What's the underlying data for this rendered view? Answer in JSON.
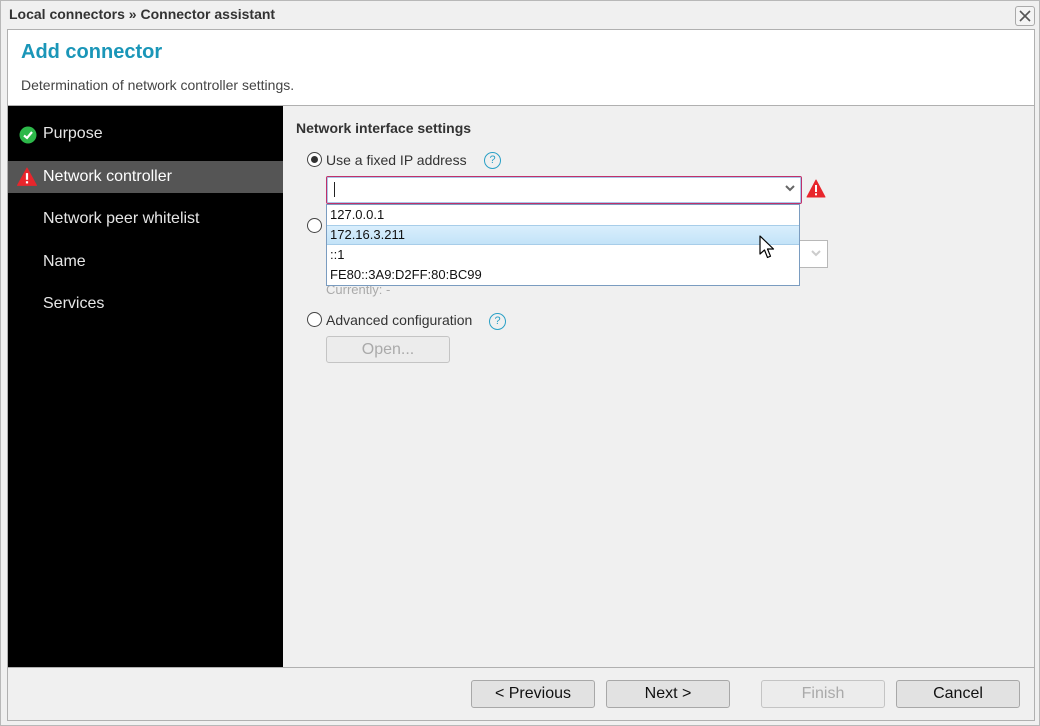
{
  "window": {
    "breadcrumb": "Local connectors » Connector assistant",
    "close_icon": "close-icon"
  },
  "header": {
    "title": "Add connector",
    "subtitle": "Determination of network controller settings."
  },
  "sidebar": {
    "items": [
      {
        "label": "Purpose",
        "status": "done",
        "icon": "check-circle-icon"
      },
      {
        "label": "Network controller",
        "status": "error",
        "icon": "warning-icon",
        "active": true
      },
      {
        "label": "Network peer whitelist",
        "status": "none"
      },
      {
        "label": "Name",
        "status": "none"
      },
      {
        "label": "Services",
        "status": "none"
      }
    ]
  },
  "content": {
    "section_title": "Network interface settings",
    "fixed_ip": {
      "label": "Use a fixed IP address",
      "checked": true,
      "value": "",
      "options": [
        "127.0.0.1",
        "172.16.3.211",
        "::1",
        "FE80::3A9:D2FF:80:BC99"
      ],
      "hovered_option": "172.16.3.211"
    },
    "second_option": {
      "checked": false,
      "currently_label": "Currently: -"
    },
    "advanced": {
      "label": "Advanced configuration",
      "checked": false,
      "open_button": "Open..."
    }
  },
  "footer": {
    "previous": "< Previous",
    "next": "Next >",
    "finish": "Finish",
    "cancel": "Cancel"
  },
  "colors": {
    "title_accent": "#1a96b8",
    "error_red": "#e8262c",
    "success_green": "#2db84a",
    "sidebar_bg": "#000000",
    "sidebar_active": "#555555"
  }
}
